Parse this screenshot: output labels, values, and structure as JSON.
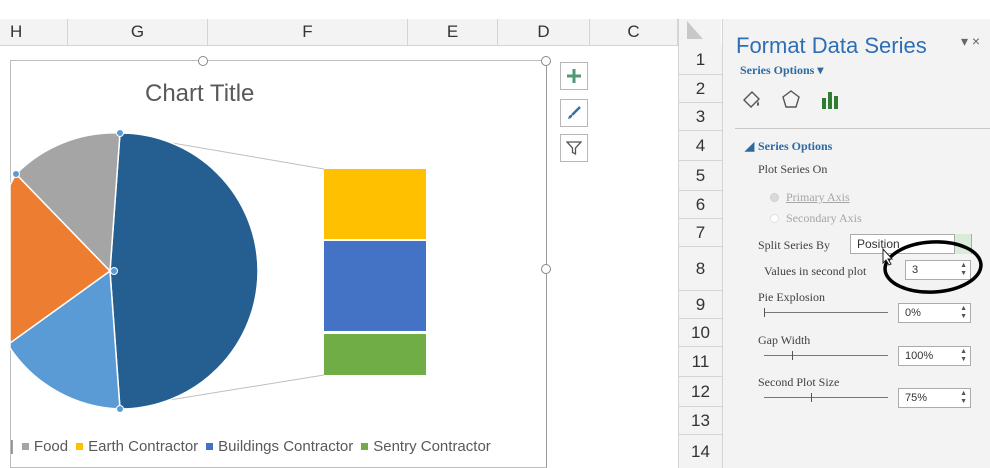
{
  "columns": [
    "H",
    "G",
    "F",
    "E",
    "D",
    "C"
  ],
  "rows": [
    "1",
    "2",
    "3",
    "4",
    "5",
    "6",
    "7",
    "8",
    "9",
    "10",
    "11",
    "12",
    "13",
    "14"
  ],
  "chart": {
    "title": "Chart Title",
    "legend": [
      {
        "label": "Food",
        "color": "#a5a5a5"
      },
      {
        "label": "Earth Contractor",
        "color": "#ffc000"
      },
      {
        "label": "Buildings Contractor",
        "color": "#4472c4"
      },
      {
        "label": "Sentry Contractor",
        "color": "#70ad47"
      }
    ],
    "colors": {
      "pie_dark_blue": "#255e91",
      "pie_light_blue": "#5b9bd5",
      "pie_orange": "#ed7d31",
      "pie_gray": "#a5a5a5",
      "bar_yellow": "#ffc000",
      "bar_blue": "#4472c4",
      "bar_green": "#70ad47"
    }
  },
  "side_buttons": [
    "plus-icon",
    "brush-icon",
    "filter-icon"
  ],
  "pane": {
    "title": "Format Data Series",
    "subtitle": "Series Options ▾",
    "close": "▾ ×",
    "tabs": [
      "fill-line-icon",
      "effects-icon",
      "series-options-icon"
    ],
    "section": "Series Options",
    "plot_series_on": "Plot Series On",
    "primary_axis": "Primary Axis",
    "secondary_axis": "Secondary Axis",
    "split_by_label": "Split Series By",
    "split_by_value": "Position",
    "values_second_label": "Values in second plot",
    "values_second_value": "3",
    "pie_explosion_label": "Pie Explosion",
    "pie_explosion_value": "0%",
    "gap_width_label": "Gap Width",
    "gap_width_value": "100%",
    "second_plot_size_label": "Second Plot Size",
    "second_plot_size_value": "75%"
  }
}
